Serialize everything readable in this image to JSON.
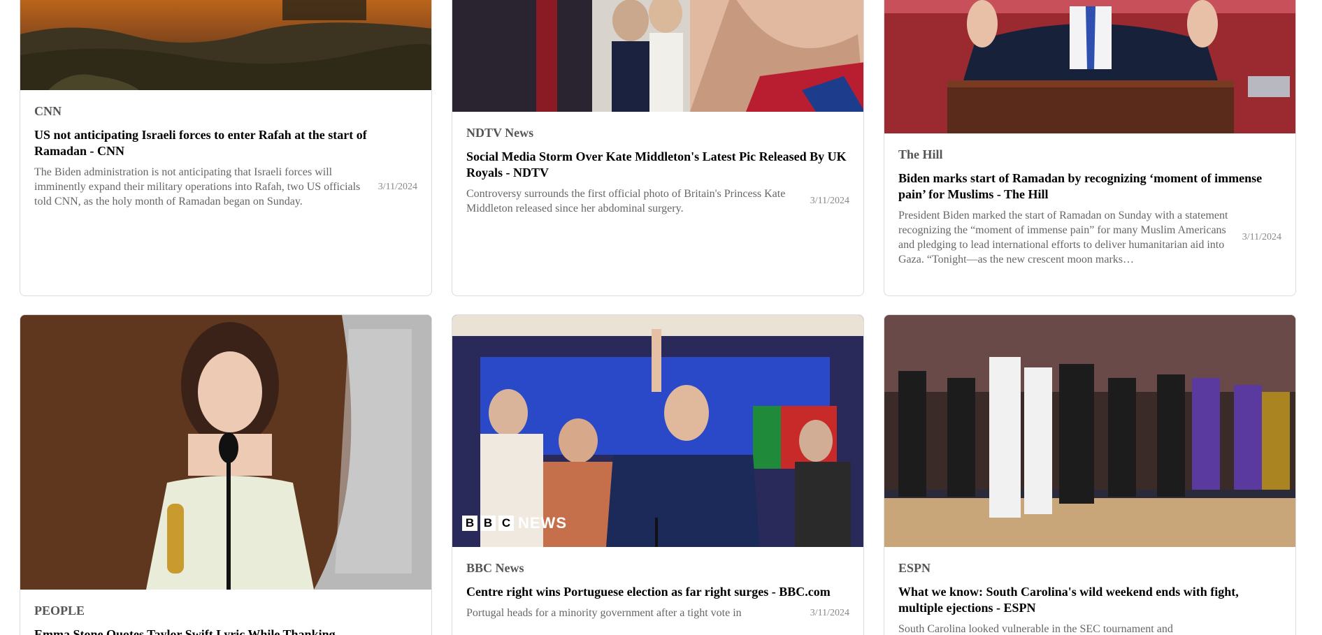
{
  "cards": [
    {
      "source": "CNN",
      "title": "US not anticipating Israeli forces to enter Rafah at the start of Ramadan - CNN",
      "summary": "The Biden administration is not anticipating that Israeli forces will imminently expand their military operations into Rafah, two US officials told CNN, as the holy month of Ramadan began on Sunday.",
      "date": "3/11/2024",
      "image": "sunset-landscape-photo"
    },
    {
      "source": "NDTV News",
      "title": "Social Media Storm Over Kate Middleton's Latest Pic Released By UK Royals - NDTV",
      "summary": "Controversy surrounds the first official photo of Britain's Princess Kate Middleton released since her abdominal surgery.",
      "date": "3/11/2024",
      "image": "royal-family-photo"
    },
    {
      "source": "The Hill",
      "title": "Biden marks start of Ramadan by recognizing ‘moment of immense pain’ for Muslims - The Hill",
      "summary": "President Biden marked the start of Ramadan on Sunday with a statement recognizing the “moment of immense pain” for many Muslim Americans and pledging to lead international efforts to deliver humanitarian aid into Gaza. “Tonight—as the new crescent moon marks…",
      "date": "3/11/2024",
      "image": "podium-speech-photo"
    },
    {
      "source": "PEOPLE",
      "title": "Emma Stone Quotes Taylor Swift Lyric While Thanking",
      "summary": "",
      "date": "",
      "image": "oscar-award-photo"
    },
    {
      "source": "BBC News",
      "title": "Centre right wins Portuguese election as far right surges - BBC.com",
      "summary": "Portugal heads for a minority government after a tight vote in",
      "date": "3/11/2024",
      "image": "election-celebration-photo",
      "image_overlay": "BBC NEWS"
    },
    {
      "source": "ESPN",
      "title": "What we know: South Carolina's wild weekend ends with fight, multiple ejections - ESPN",
      "summary": "South Carolina looked vulnerable in the SEC tournament and",
      "date": "",
      "image": "basketball-fight-photo"
    }
  ]
}
